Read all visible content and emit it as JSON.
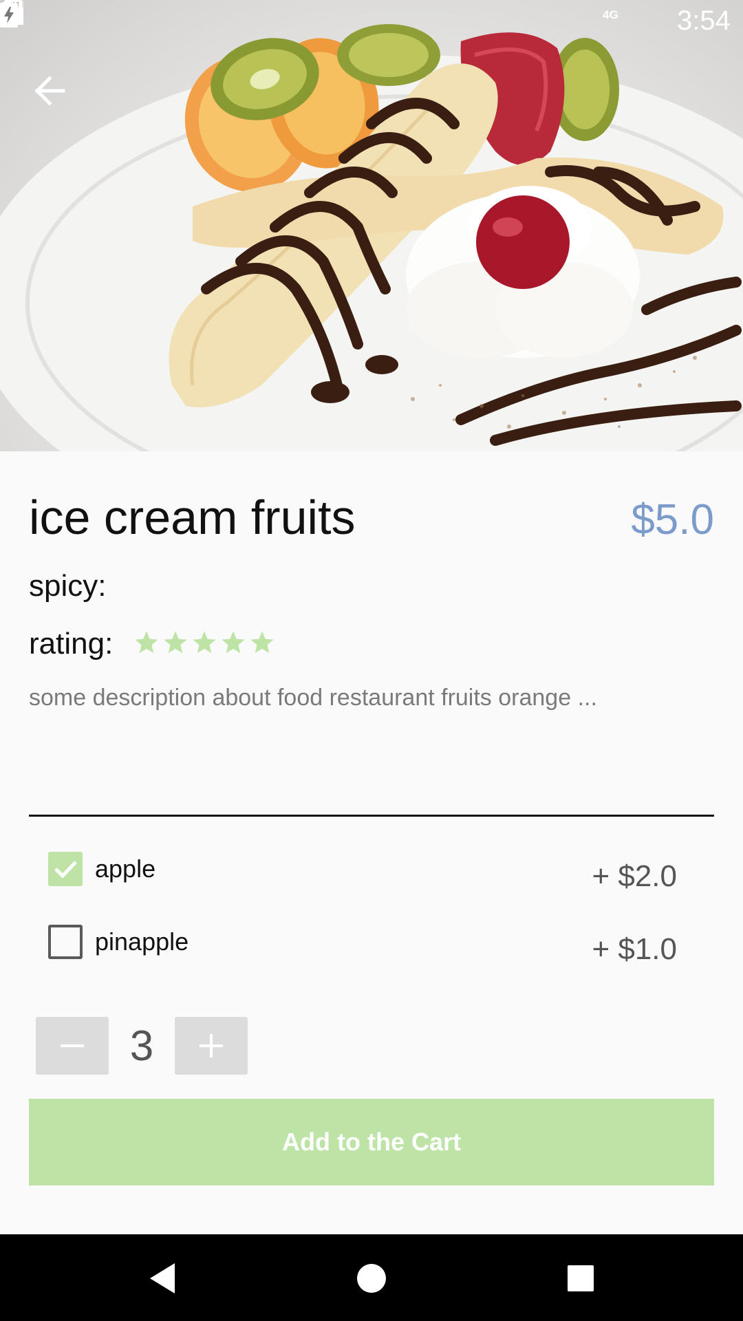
{
  "status_bar": {
    "network": "4G",
    "time": "3:54",
    "icons": [
      "sd-card-icon",
      "signal-icon",
      "battery-charging-icon"
    ]
  },
  "header": {
    "back_icon": "arrow-back-icon",
    "hero_image": "banana-split-with-whipped-cream-chocolate-and-fruits"
  },
  "product": {
    "title": "ice cream fruits",
    "price": "$5.0",
    "spicy_label": "spicy:",
    "rating_label": "rating:",
    "rating": 5,
    "rating_max": 5,
    "description": "some description about food restaurant fruits orange ..."
  },
  "options": [
    {
      "label": "apple",
      "price": "+ $2.0",
      "checked": true
    },
    {
      "label": "pinapple",
      "price": "+ $1.0",
      "checked": false
    }
  ],
  "quantity": {
    "value": "3",
    "minus_icon": "minus-icon",
    "plus_icon": "plus-icon"
  },
  "cart_button": {
    "label": "Add to the Cart"
  },
  "nav_bar": {
    "icons": [
      "nav-back-icon",
      "nav-home-icon",
      "nav-recents-icon"
    ]
  },
  "colors": {
    "accent_green": "#bde4a6",
    "price_blue": "#7b9cca",
    "background": "#fafafa",
    "nav_bar": "#000000"
  }
}
